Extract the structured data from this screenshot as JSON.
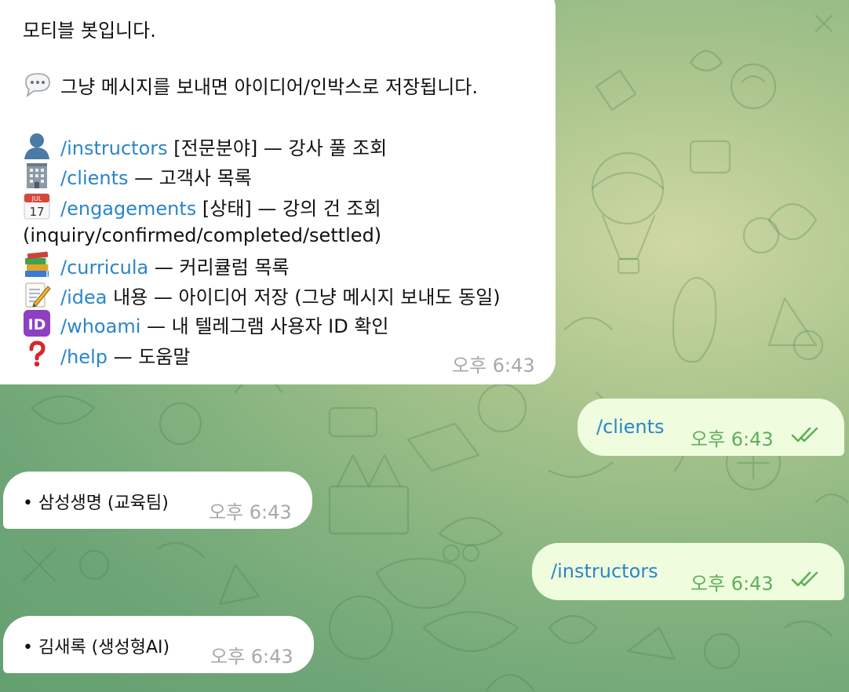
{
  "menu_message": {
    "greeting": "모티블 봇입니다.",
    "hint": "그냥 메시지를 보내면 아이디어/인박스로 저장됩니다.",
    "commands": [
      {
        "icon": "bust-silhouette-icon",
        "command": "/instructors",
        "desc": " [전문분야] — 강사 풀 조회"
      },
      {
        "icon": "office-building-icon",
        "command": "/clients",
        "desc": " — 고객사 목록"
      },
      {
        "icon": "calendar-icon",
        "command": "/engagements",
        "desc": " [상태] — 강의 건 조회"
      },
      {
        "icon": "books-icon",
        "command": "/curricula",
        "desc": " — 커리큘럼 목록"
      },
      {
        "icon": "memo-icon",
        "command": "/idea",
        "desc": " 내용 — 아이디어 저장 (그냥 메시지 보내도 동일)"
      },
      {
        "icon": "id-icon",
        "command": "/whoami",
        "desc": " — 내 텔레그램 사용자 ID 확인"
      },
      {
        "icon": "question-mark-icon",
        "command": "/help",
        "desc": " — 도움말"
      }
    ],
    "engagement_states": "(inquiry/confirmed/completed/settled)",
    "calendar_month": "JUL",
    "calendar_day": "17",
    "id_label": "ID",
    "time": "오후 6:43"
  },
  "outgoing_clients": {
    "text": "/clients",
    "time": "오후 6:43"
  },
  "reply_clients": {
    "text": "• 삼성생명 (교육팀)",
    "time": "오후 6:43"
  },
  "outgoing_instructors": {
    "text": "/instructors",
    "time": "오후 6:43"
  },
  "reply_instructors": {
    "text": "• 김새록 (생성형AI)",
    "time": "오후 6:43"
  },
  "colors": {
    "link": "#2a86c8",
    "outgoing_bubble": "#effdde",
    "incoming_bubble": "#ffffff",
    "outgoing_time": "#5fae5a",
    "incoming_time": "#a4aaa9"
  }
}
